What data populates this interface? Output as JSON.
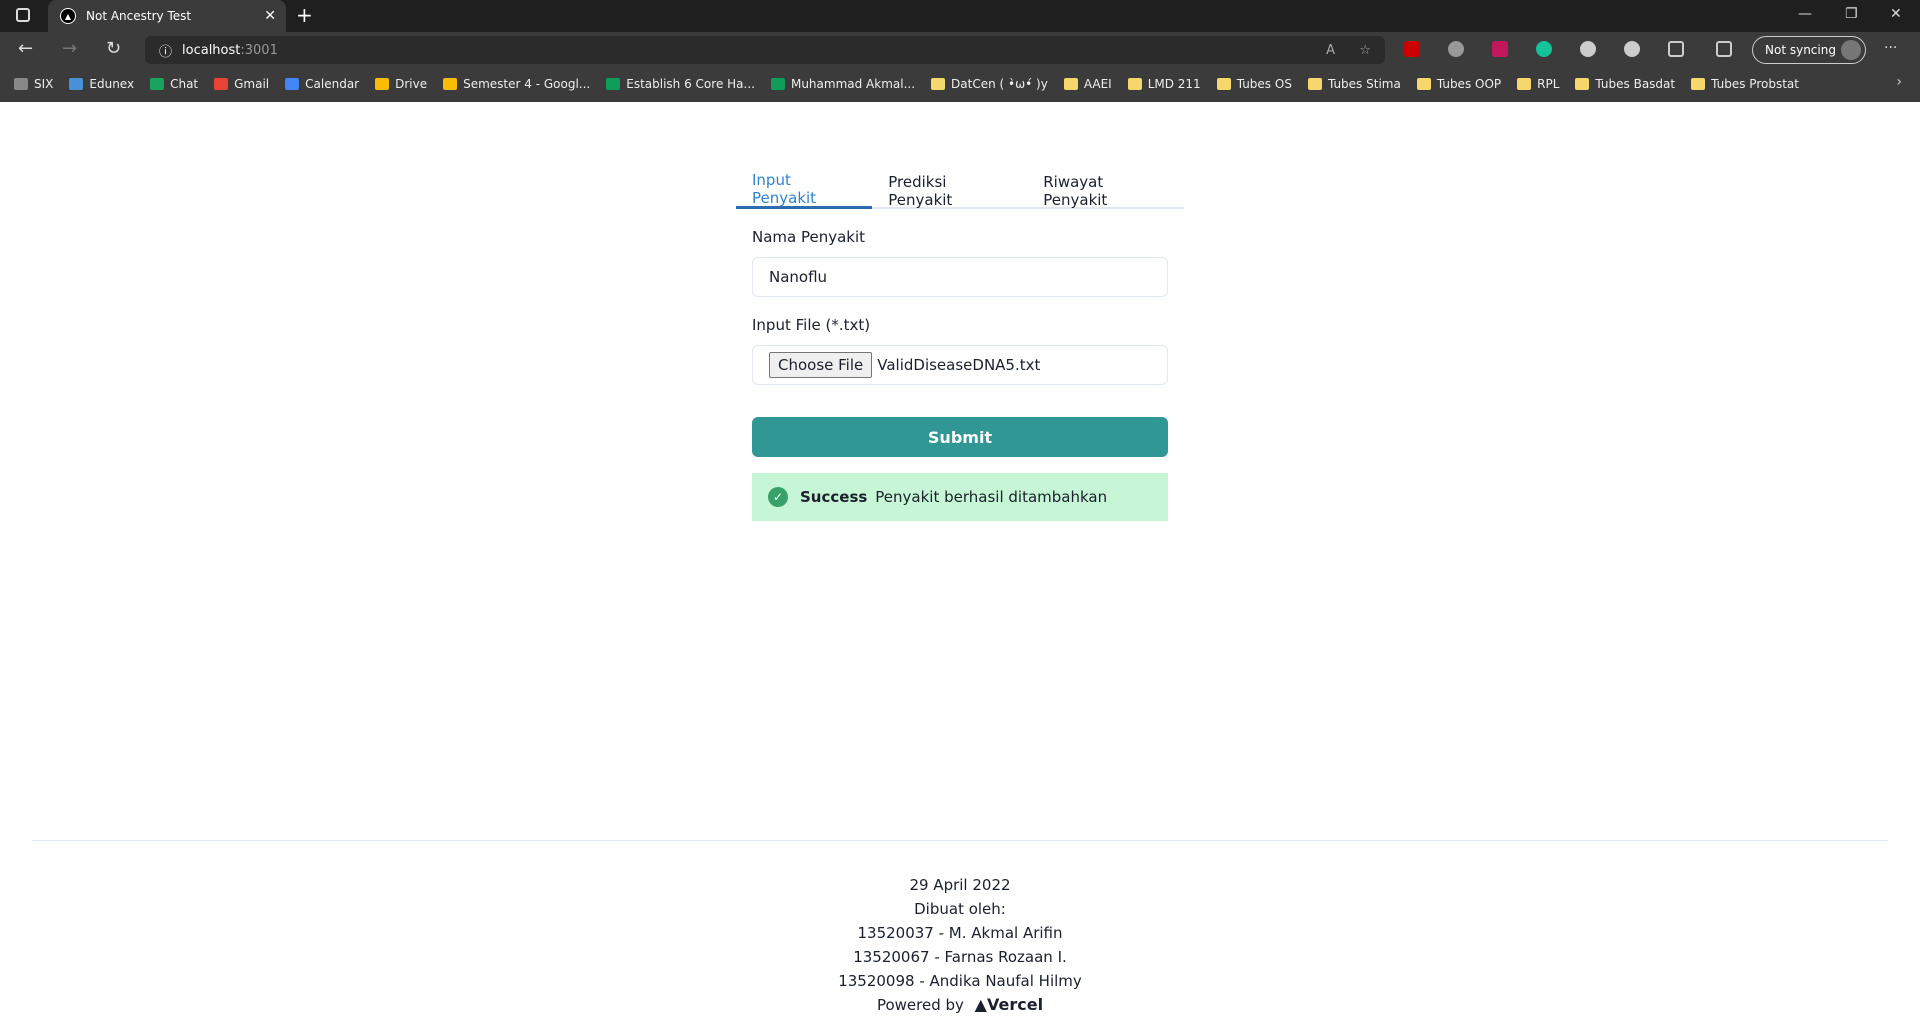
{
  "browser": {
    "tab_title": "Not Ancestry Test",
    "url_host": "localhost",
    "url_port": ":3001",
    "sync_label": "Not syncing",
    "bookmarks": [
      "SIX",
      "Edunex",
      "Chat",
      "Gmail",
      "Calendar",
      "Drive",
      "Semester 4 - Googl...",
      "Establish 6 Core Ha...",
      "Muhammad Akmal...",
      "DatCen ( •̀ω•́ )y",
      "AAEI",
      "LMD 211",
      "Tubes OS",
      "Tubes Stima",
      "Tubes OOP",
      "RPL",
      "Tubes Basdat",
      "Tubes Probstat"
    ]
  },
  "tabs": [
    "Input Penyakit",
    "Prediksi Penyakit",
    "Riwayat Penyakit"
  ],
  "form": {
    "name_label": "Nama Penyakit",
    "name_value": "Nanoflu",
    "file_label": "Input File (*.txt)",
    "choose_file": "Choose File",
    "file_name": "ValidDiseaseDNA5.txt",
    "submit": "Submit"
  },
  "alert": {
    "title": "Success",
    "message": "Penyakit berhasil ditambahkan",
    "color": "#c6f6d5"
  },
  "footer": {
    "date": "29 April 2022",
    "made_by": "Dibuat oleh:",
    "authors": [
      "13520037 - M. Akmal Arifin",
      "13520067 - Farnas Rozaan I.",
      "13520098 - Andika Naufal Hilmy"
    ],
    "powered_by": "Powered by",
    "vercel": "Vercel"
  },
  "colors": {
    "accent": "#319795",
    "tab_active": "#3182ce"
  }
}
